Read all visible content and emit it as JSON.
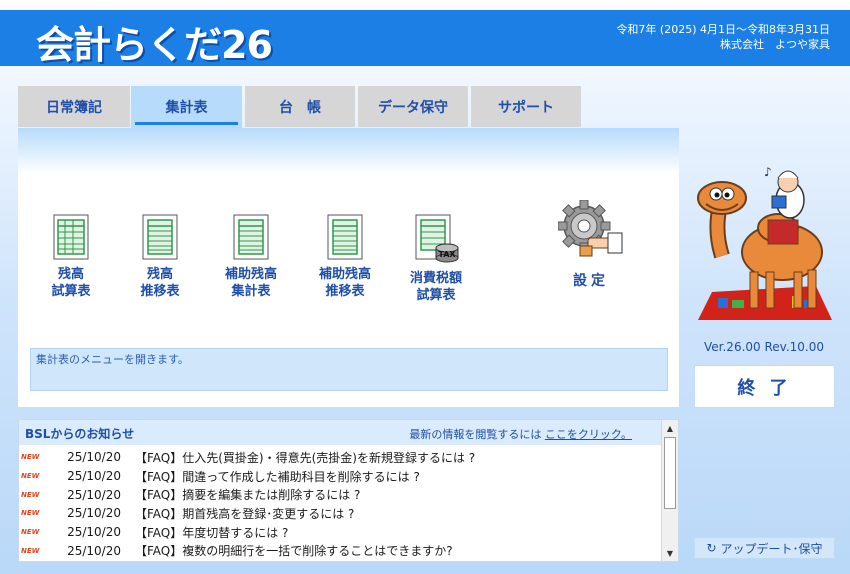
{
  "app": {
    "title": "会計らくだ26",
    "period": "令和7年 (2025) 4月1日～令和8年3月31日",
    "company": "株式会社　よつや家具",
    "version": "Ver.26.00 Rev.10.00"
  },
  "tabs": [
    {
      "label": "日常簿記",
      "active": false
    },
    {
      "label": "集計表",
      "active": true
    },
    {
      "label": "台　帳",
      "active": false
    },
    {
      "label": "データ保守",
      "active": false
    },
    {
      "label": "サポート",
      "active": false
    }
  ],
  "menu": [
    {
      "label": "残高\n試算表",
      "icon": "spreadsheet-icon"
    },
    {
      "label": "残高\n推移表",
      "icon": "list-sheet-icon"
    },
    {
      "label": "補助残高\n集計表",
      "icon": "list-sheet-icon"
    },
    {
      "label": "補助残高\n推移表",
      "icon": "list-sheet-icon"
    },
    {
      "label": "消費税額\n試算表",
      "icon": "tax-sheet-icon"
    }
  ],
  "settings": {
    "label": "設定",
    "icon": "gear-hand-icon"
  },
  "status_text": "集計表のメニューを開きます。",
  "exit_label": "終 了",
  "update_label": "アップデート･保守",
  "news": {
    "title": "BSLからのお知らせ",
    "link_prefix": "最新の情報を閲覧するには",
    "link_label": "ここをクリック。",
    "badge": "NEW",
    "items": [
      {
        "date": "25/10/20",
        "text": "【FAQ】仕入先(買掛金)・得意先(売掛金)を新規登録するには ?"
      },
      {
        "date": "25/10/20",
        "text": "【FAQ】間違って作成した補助科目を削除するには ?"
      },
      {
        "date": "25/10/20",
        "text": "【FAQ】摘要を編集または削除するには ?"
      },
      {
        "date": "25/10/20",
        "text": "【FAQ】期首残高を登録･変更するには ?"
      },
      {
        "date": "25/10/20",
        "text": "【FAQ】年度切替するには ?"
      },
      {
        "date": "25/10/20",
        "text": "【FAQ】複数の明細行を一括で削除することはできますか?"
      }
    ]
  },
  "colors": {
    "brand": "#1c7fe6",
    "accent_text": "#1f4fa8",
    "new_badge": "#e8431c",
    "sheet_green": "#2e9a4a"
  }
}
